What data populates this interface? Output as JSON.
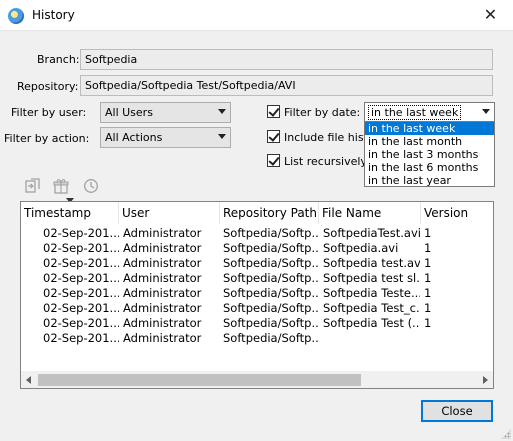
{
  "window": {
    "title": "History",
    "close_glyph": "✕"
  },
  "form": {
    "branch_label": "Branch:",
    "branch_value": "Softpedia",
    "repository_label": "Repository:",
    "repository_value": "Softpedia/Softpedia Test/Softpedia/AVI",
    "filter_user_label": "Filter by user:",
    "filter_user_value": "All Users",
    "filter_action_label": "Filter by action:",
    "filter_action_value": "All Actions",
    "filter_date_label": "Filter by date:",
    "filter_date_checked": true,
    "filter_date_value": "in the last week",
    "include_history_label": "Include file history",
    "include_history_checked": true,
    "list_recursively_label": "List recursively",
    "list_recursively_checked": true
  },
  "date_options": [
    "in the last week",
    "in the last month",
    "in the last 3 months",
    "in the last 6 months",
    "in the last year"
  ],
  "toolbar_icons": [
    "compare-icon",
    "gift-box-icon",
    "clock-icon"
  ],
  "table": {
    "columns": [
      "Timestamp",
      "User",
      "Repository Path",
      "File Name",
      "Version"
    ],
    "rows": [
      [
        "02-Sep-201...",
        "Administrator",
        "Softpedia/Softp...",
        "SoftpediaTest.avi",
        "1"
      ],
      [
        "02-Sep-201...",
        "Administrator",
        "Softpedia/Softp...",
        "Softpedia.avi",
        "1"
      ],
      [
        "02-Sep-201...",
        "Administrator",
        "Softpedia/Softp...",
        "Softpedia test.avi",
        "1"
      ],
      [
        "02-Sep-201...",
        "Administrator",
        "Softpedia/Softp...",
        "Softpedia test sl...",
        "1"
      ],
      [
        "02-Sep-201...",
        "Administrator",
        "Softpedia/Softp...",
        "Softpedia Teste...",
        "1"
      ],
      [
        "02-Sep-201...",
        "Administrator",
        "Softpedia/Softp...",
        "Softpedia Test_c...",
        "1"
      ],
      [
        "02-Sep-201...",
        "Administrator",
        "Softpedia/Softp...",
        "Softpedia Test (...",
        "1"
      ],
      [
        "02-Sep-201...",
        "Administrator",
        "Softpedia/Softp...",
        "",
        ""
      ]
    ]
  },
  "buttons": {
    "close_label": "Close"
  },
  "colors": {
    "accent": "#0078d7"
  }
}
